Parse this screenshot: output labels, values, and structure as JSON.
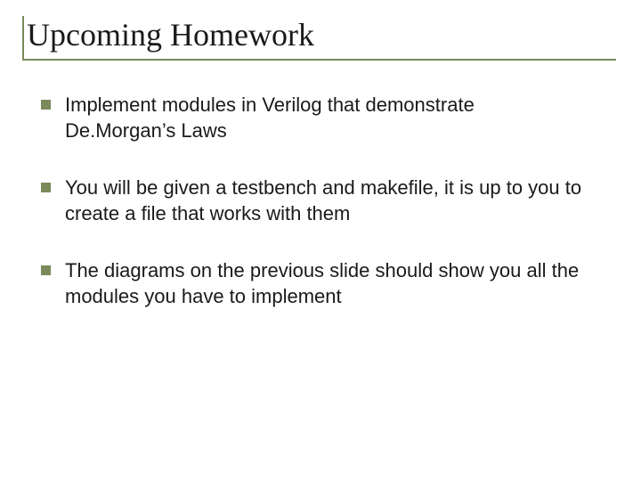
{
  "title": "Upcoming Homework",
  "bullets": [
    {
      "text": "Implement modules in Verilog that demonstrate De.Morgan’s Laws"
    },
    {
      "text": "You will be given a testbench and makefile, it is up to you to create a file that works with them"
    },
    {
      "text": "The diagrams on the previous slide should show you all the modules you have to implement"
    }
  ],
  "colors": {
    "accent": "#7a8a5a"
  }
}
